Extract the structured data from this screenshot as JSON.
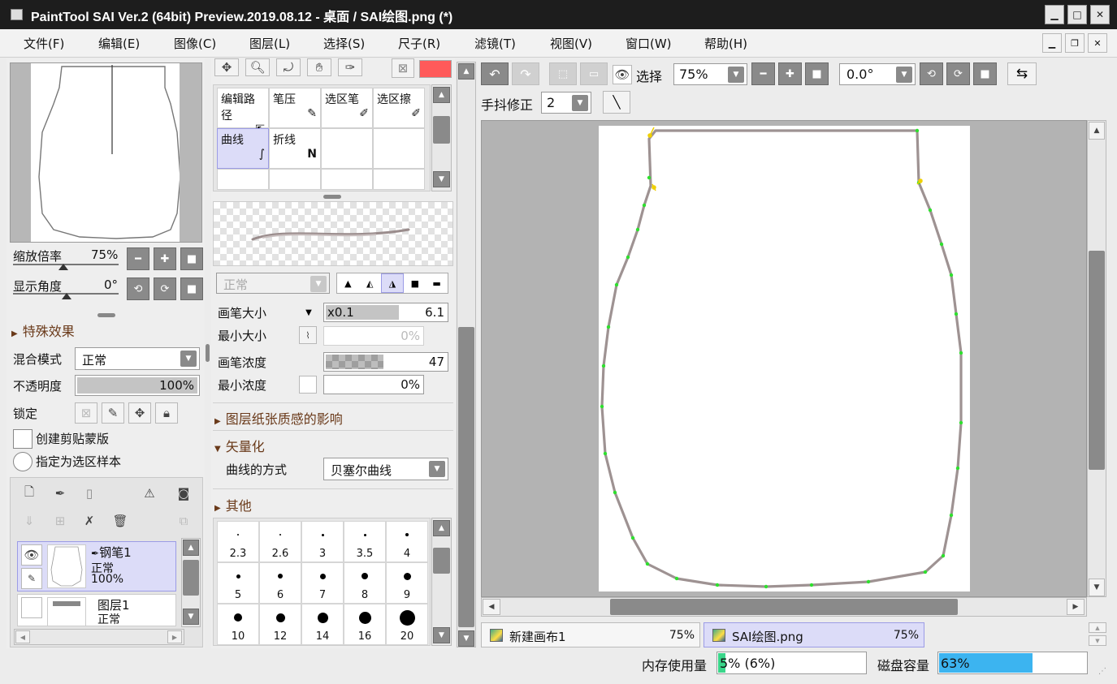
{
  "window": {
    "title": "PaintTool SAI Ver.2 (64bit) Preview.2019.08.12 - 桌面 / SAI绘图.png (*)"
  },
  "menu": [
    "文件(F)",
    "编辑(E)",
    "图像(C)",
    "图层(L)",
    "选择(S)",
    "尺子(R)",
    "滤镜(T)",
    "视图(V)",
    "窗口(W)",
    "帮助(H)"
  ],
  "navigator": {
    "zoom_label": "缩放倍率",
    "zoom_value": "75%",
    "angle_label": "显示角度",
    "angle_value": "0°"
  },
  "effects": {
    "label": "特殊效果"
  },
  "layer_props": {
    "blend_label": "混合模式",
    "blend_value": "正常",
    "opacity_label": "不透明度",
    "opacity_value": "100%",
    "opacity_fraction": 1.0,
    "lock_label": "锁定",
    "clip_label": "创建剪贴蒙版",
    "sample_label": "指定为选区样本"
  },
  "layers": [
    {
      "name": "钢笔1",
      "mode": "正常",
      "opacity": "100%",
      "selected": true
    },
    {
      "name": "图层1",
      "mode": "正常",
      "selected": false
    }
  ],
  "tools": {
    "primary_color": "#ff5a5a",
    "items": [
      {
        "label": "编辑路径",
        "glyph": "⇱",
        "selected": false
      },
      {
        "label": "笔压",
        "glyph": "✎",
        "selected": false
      },
      {
        "label": "选区笔",
        "glyph": "✐",
        "selected": false
      },
      {
        "label": "选区擦",
        "glyph": "✐",
        "selected": false
      },
      {
        "label": "曲线",
        "glyph": "∫",
        "selected": true
      },
      {
        "label": "折线",
        "glyph": "N",
        "selected": false
      }
    ]
  },
  "brush": {
    "mode_value": "正常",
    "size_label": "画笔大小",
    "size_mult": "x0.1",
    "size_value": "6.1",
    "min_size_label": "最小大小",
    "min_size_value": "0%",
    "density_label": "画笔浓度",
    "density_value": "47",
    "density_fraction": 0.47,
    "min_density_label": "最小浓度",
    "min_density_value": "0%"
  },
  "sections": {
    "paper": "图层纸张质感的影响",
    "vector": "矢量化",
    "curve_label": "曲线的方式",
    "curve_value": "贝塞尔曲线",
    "other": "其他"
  },
  "brush_sizes": [
    "2.3",
    "2.6",
    "3",
    "3.5",
    "4",
    "5",
    "6",
    "7",
    "8",
    "9",
    "10",
    "12",
    "14",
    "16",
    "20"
  ],
  "canvas_toolbar": {
    "select_label": "选择",
    "zoom_value": "75%",
    "angle_value": "0.0°",
    "stabilizer_label": "手抖修正",
    "stabilizer_value": "2"
  },
  "canvas_tabs": [
    {
      "name": "新建画布1",
      "zoom": "75%",
      "active": false
    },
    {
      "name": "SAI绘图.png",
      "zoom": "75%",
      "active": true
    }
  ],
  "status": {
    "mem_label": "内存使用量",
    "mem_value": "5% (6%)",
    "mem_fraction": 0.05,
    "disk_label": "磁盘容量",
    "disk_value": "63%",
    "disk_fraction": 0.63
  }
}
